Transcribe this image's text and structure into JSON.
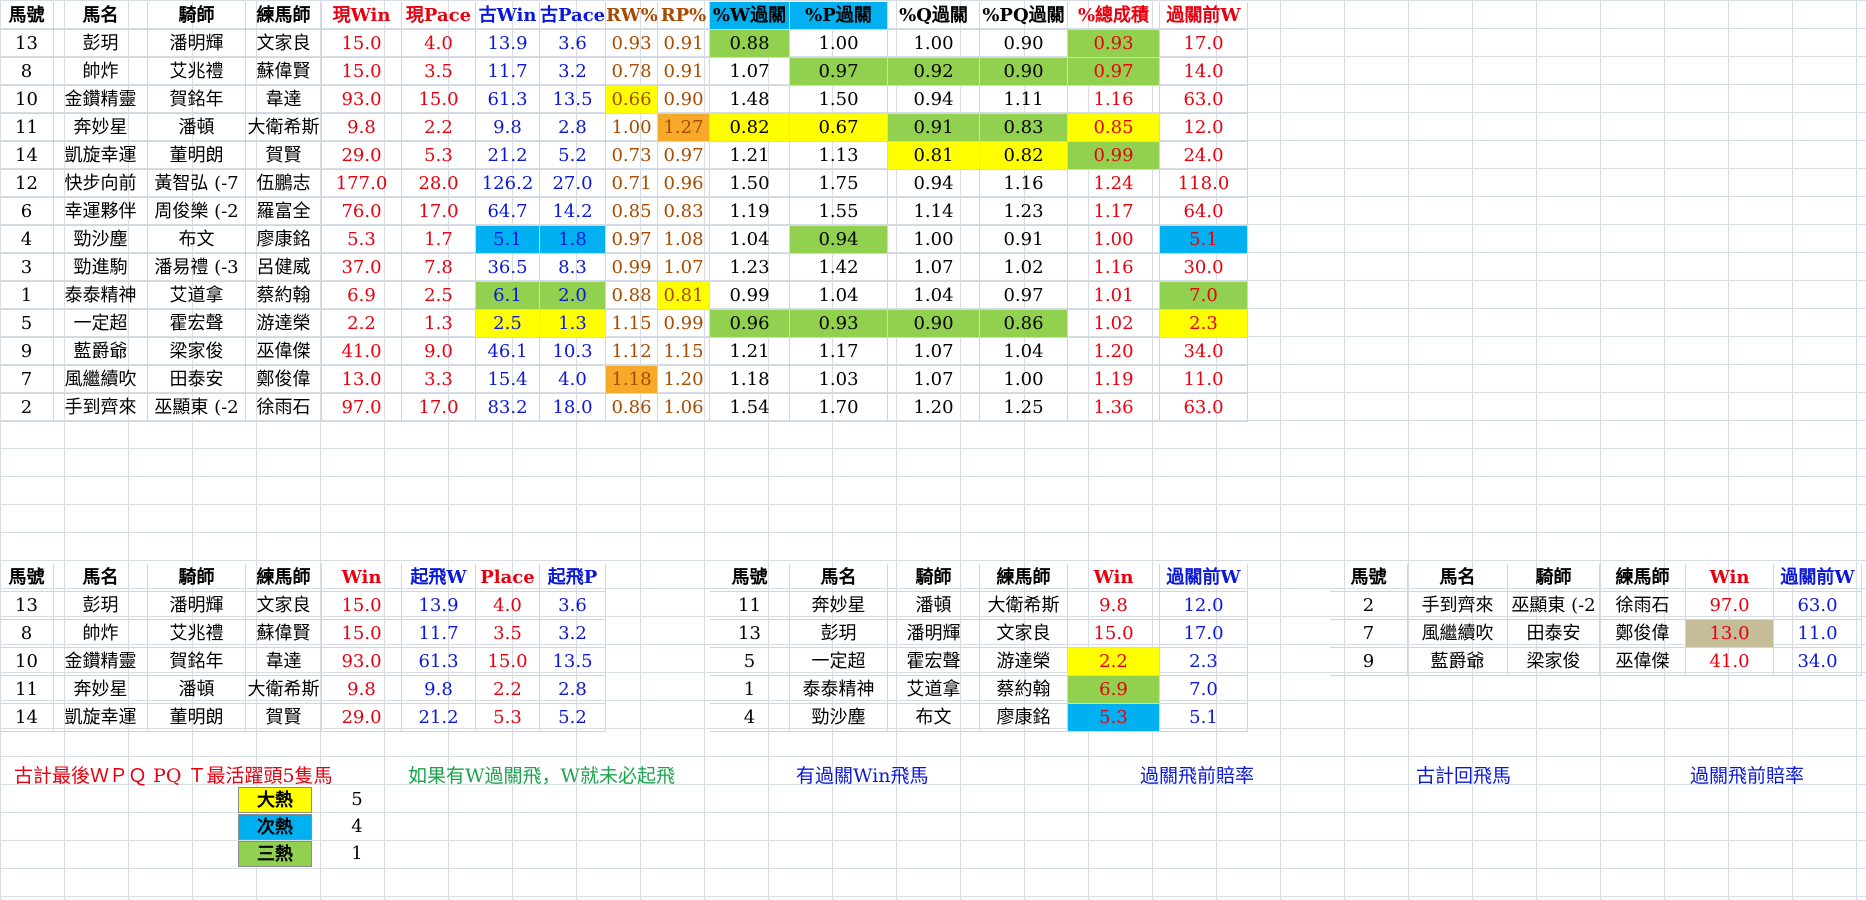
{
  "top_table": {
    "headers": [
      "馬號",
      "馬名",
      "騎師",
      "練馬師",
      "現Win",
      "現Pace",
      "古Win",
      "古Pace",
      "RW%",
      "RP%",
      "%W過關",
      "%P過關",
      "%Q過關",
      "%PQ過關",
      "%總成積",
      "過關前W"
    ],
    "rows": [
      [
        "13",
        "彭玥",
        "潘明輝",
        "文家良",
        "15.0",
        "4.0",
        "13.9",
        "3.6",
        "0.93",
        "0.91",
        "0.88",
        "1.00",
        "1.00",
        "0.90",
        "0.93",
        "17.0"
      ],
      [
        "8",
        "帥炸",
        "艾兆禮",
        "蘇偉賢",
        "15.0",
        "3.5",
        "11.7",
        "3.2",
        "0.78",
        "0.91",
        "1.07",
        "0.97",
        "0.92",
        "0.90",
        "0.97",
        "14.0"
      ],
      [
        "10",
        "金鑽精靈",
        "賀銘年",
        "韋達",
        "93.0",
        "15.0",
        "61.3",
        "13.5",
        "0.66",
        "0.90",
        "1.48",
        "1.50",
        "0.94",
        "1.11",
        "1.16",
        "63.0"
      ],
      [
        "11",
        "奔妙星",
        "潘頓",
        "大衛希斯",
        "9.8",
        "2.2",
        "9.8",
        "2.8",
        "1.00",
        "1.27",
        "0.82",
        "0.67",
        "0.91",
        "0.83",
        "0.85",
        "12.0"
      ],
      [
        "14",
        "凱旋幸運",
        "董明朗",
        "賀賢",
        "29.0",
        "5.3",
        "21.2",
        "5.2",
        "0.73",
        "0.97",
        "1.21",
        "1.13",
        "0.81",
        "0.82",
        "0.99",
        "24.0"
      ],
      [
        "12",
        "快步向前",
        "黃智弘 (-7",
        "伍鵬志",
        "177.0",
        "28.0",
        "126.2",
        "27.0",
        "0.71",
        "0.96",
        "1.50",
        "1.75",
        "0.94",
        "1.16",
        "1.24",
        "118.0"
      ],
      [
        "6",
        "幸運夥伴",
        "周俊樂 (-2",
        "羅富全",
        "76.0",
        "17.0",
        "64.7",
        "14.2",
        "0.85",
        "0.83",
        "1.19",
        "1.55",
        "1.14",
        "1.23",
        "1.17",
        "64.0"
      ],
      [
        "4",
        "勁沙塵",
        "布文",
        "廖康銘",
        "5.3",
        "1.7",
        "5.1",
        "1.8",
        "0.97",
        "1.08",
        "1.04",
        "0.94",
        "1.00",
        "0.91",
        "1.00",
        "5.1"
      ],
      [
        "3",
        "勁進駒",
        "潘易禮 (-3",
        "呂健威",
        "37.0",
        "7.8",
        "36.5",
        "8.3",
        "0.99",
        "1.07",
        "1.23",
        "1.42",
        "1.07",
        "1.02",
        "1.16",
        "30.0"
      ],
      [
        "1",
        "泰泰精神",
        "艾道拿",
        "蔡約翰",
        "6.9",
        "2.5",
        "6.1",
        "2.0",
        "0.88",
        "0.81",
        "0.99",
        "1.04",
        "1.04",
        "0.97",
        "1.01",
        "7.0"
      ],
      [
        "5",
        "一定超",
        "霍宏聲",
        "游達榮",
        "2.2",
        "1.3",
        "2.5",
        "1.3",
        "1.15",
        "0.99",
        "0.96",
        "0.93",
        "0.90",
        "0.86",
        "1.02",
        "2.3"
      ],
      [
        "9",
        "藍爵爺",
        "梁家俊",
        "巫偉傑",
        "41.0",
        "9.0",
        "46.1",
        "10.3",
        "1.12",
        "1.15",
        "1.21",
        "1.17",
        "1.07",
        "1.04",
        "1.20",
        "34.0"
      ],
      [
        "7",
        "風繼續吹",
        "田泰安",
        "鄭俊偉",
        "13.0",
        "3.3",
        "15.4",
        "4.0",
        "1.18",
        "1.20",
        "1.18",
        "1.03",
        "1.07",
        "1.00",
        "1.19",
        "11.0"
      ],
      [
        "2",
        "手到齊來",
        "巫顯東 (-2",
        "徐雨石",
        "97.0",
        "17.0",
        "83.2",
        "18.0",
        "0.86",
        "1.06",
        "1.54",
        "1.70",
        "1.20",
        "1.25",
        "1.36",
        "63.0"
      ]
    ],
    "highlights": {
      "0": {
        "10": "#92d050",
        "14": "#92d050"
      },
      "1": {
        "11": "#92d050",
        "12": "#92d050",
        "13": "#92d050",
        "14": "#92d050"
      },
      "2": {
        "8": "#ffff00"
      },
      "3": {
        "9": "#f7a92a",
        "10": "#ffff00",
        "11": "#ffff00",
        "12": "#92d050",
        "13": "#92d050",
        "14": "#ffff00"
      },
      "4": {
        "12": "#ffff00",
        "13": "#ffff00",
        "14": "#92d050"
      },
      "7": {
        "6": "#00b0f0",
        "7": "#00b0f0",
        "11": "#92d050",
        "15": "#00b0f0"
      },
      "9": {
        "6": "#92d050",
        "7": "#92d050",
        "9": "#ffff00",
        "15": "#92d050"
      },
      "10": {
        "6": "#ffff00",
        "7": "#ffff00",
        "10": "#92d050",
        "11": "#92d050",
        "12": "#92d050",
        "13": "#92d050",
        "15": "#ffff00"
      },
      "12": {
        "8": "#f7a92a"
      }
    }
  },
  "bottom_left_table": {
    "headers": [
      "馬號",
      "馬名",
      "騎師",
      "練馬師",
      "Win",
      "起飛W",
      "Place",
      "起飛P"
    ],
    "rows": [
      [
        "13",
        "彭玥",
        "潘明輝",
        "文家良",
        "15.0",
        "13.9",
        "4.0",
        "3.6"
      ],
      [
        "8",
        "帥炸",
        "艾兆禮",
        "蘇偉賢",
        "15.0",
        "11.7",
        "3.5",
        "3.2"
      ],
      [
        "10",
        "金鑽精靈",
        "賀銘年",
        "韋達",
        "93.0",
        "61.3",
        "15.0",
        "13.5"
      ],
      [
        "11",
        "奔妙星",
        "潘頓",
        "大衛希斯",
        "9.8",
        "9.8",
        "2.2",
        "2.8"
      ],
      [
        "14",
        "凱旋幸運",
        "董明朗",
        "賀賢",
        "29.0",
        "21.2",
        "5.3",
        "5.2"
      ]
    ]
  },
  "bottom_mid_table": {
    "headers": [
      "馬號",
      "馬名",
      "騎師",
      "練馬師",
      "Win",
      "過關前W"
    ],
    "rows": [
      [
        "11",
        "奔妙星",
        "潘頓",
        "大衛希斯",
        "9.8",
        "12.0"
      ],
      [
        "13",
        "彭玥",
        "潘明輝",
        "文家良",
        "15.0",
        "17.0"
      ],
      [
        "5",
        "一定超",
        "霍宏聲",
        "游達榮",
        "2.2",
        "2.3"
      ],
      [
        "1",
        "泰泰精神",
        "艾道拿",
        "蔡約翰",
        "6.9",
        "7.0"
      ],
      [
        "4",
        "勁沙塵",
        "布文",
        "廖康銘",
        "5.3",
        "5.1"
      ]
    ],
    "win_highlights": [
      "",
      "",
      "#ffff00",
      "#92d050",
      "#00b0f0"
    ]
  },
  "bottom_right_table": {
    "headers": [
      "馬號",
      "馬名",
      "騎師",
      "練馬師",
      "Win",
      "過關前W"
    ],
    "rows": [
      [
        "2",
        "手到齊來",
        "巫顯東 (-2",
        "徐雨石",
        "97.0",
        "63.0"
      ],
      [
        "7",
        "風繼續吹",
        "田泰安",
        "鄭俊偉",
        "13.0",
        "11.0"
      ],
      [
        "9",
        "藍爵爺",
        "梁家俊",
        "巫偉傑",
        "41.0",
        "34.0"
      ]
    ],
    "win_highlights": [
      "",
      "#c4bd97",
      ""
    ]
  },
  "notes": {
    "left": "古計最後ＷＰＱ PQ Ｔ最活躍頭5隻馬",
    "mid_green": "如果有W過關飛，W就未必起飛",
    "mid_blue": "有過關Win飛馬",
    "mid_rate": "過關飛前賠率",
    "right_blue": "古計回飛馬",
    "right_rate": "過關飛前賠率"
  },
  "legend": [
    {
      "label": "大熱",
      "value": "5",
      "color": "#ffff00"
    },
    {
      "label": "次熱",
      "value": "4",
      "color": "#00b0f0"
    },
    {
      "label": "三熱",
      "value": "1",
      "color": "#92d050"
    }
  ]
}
